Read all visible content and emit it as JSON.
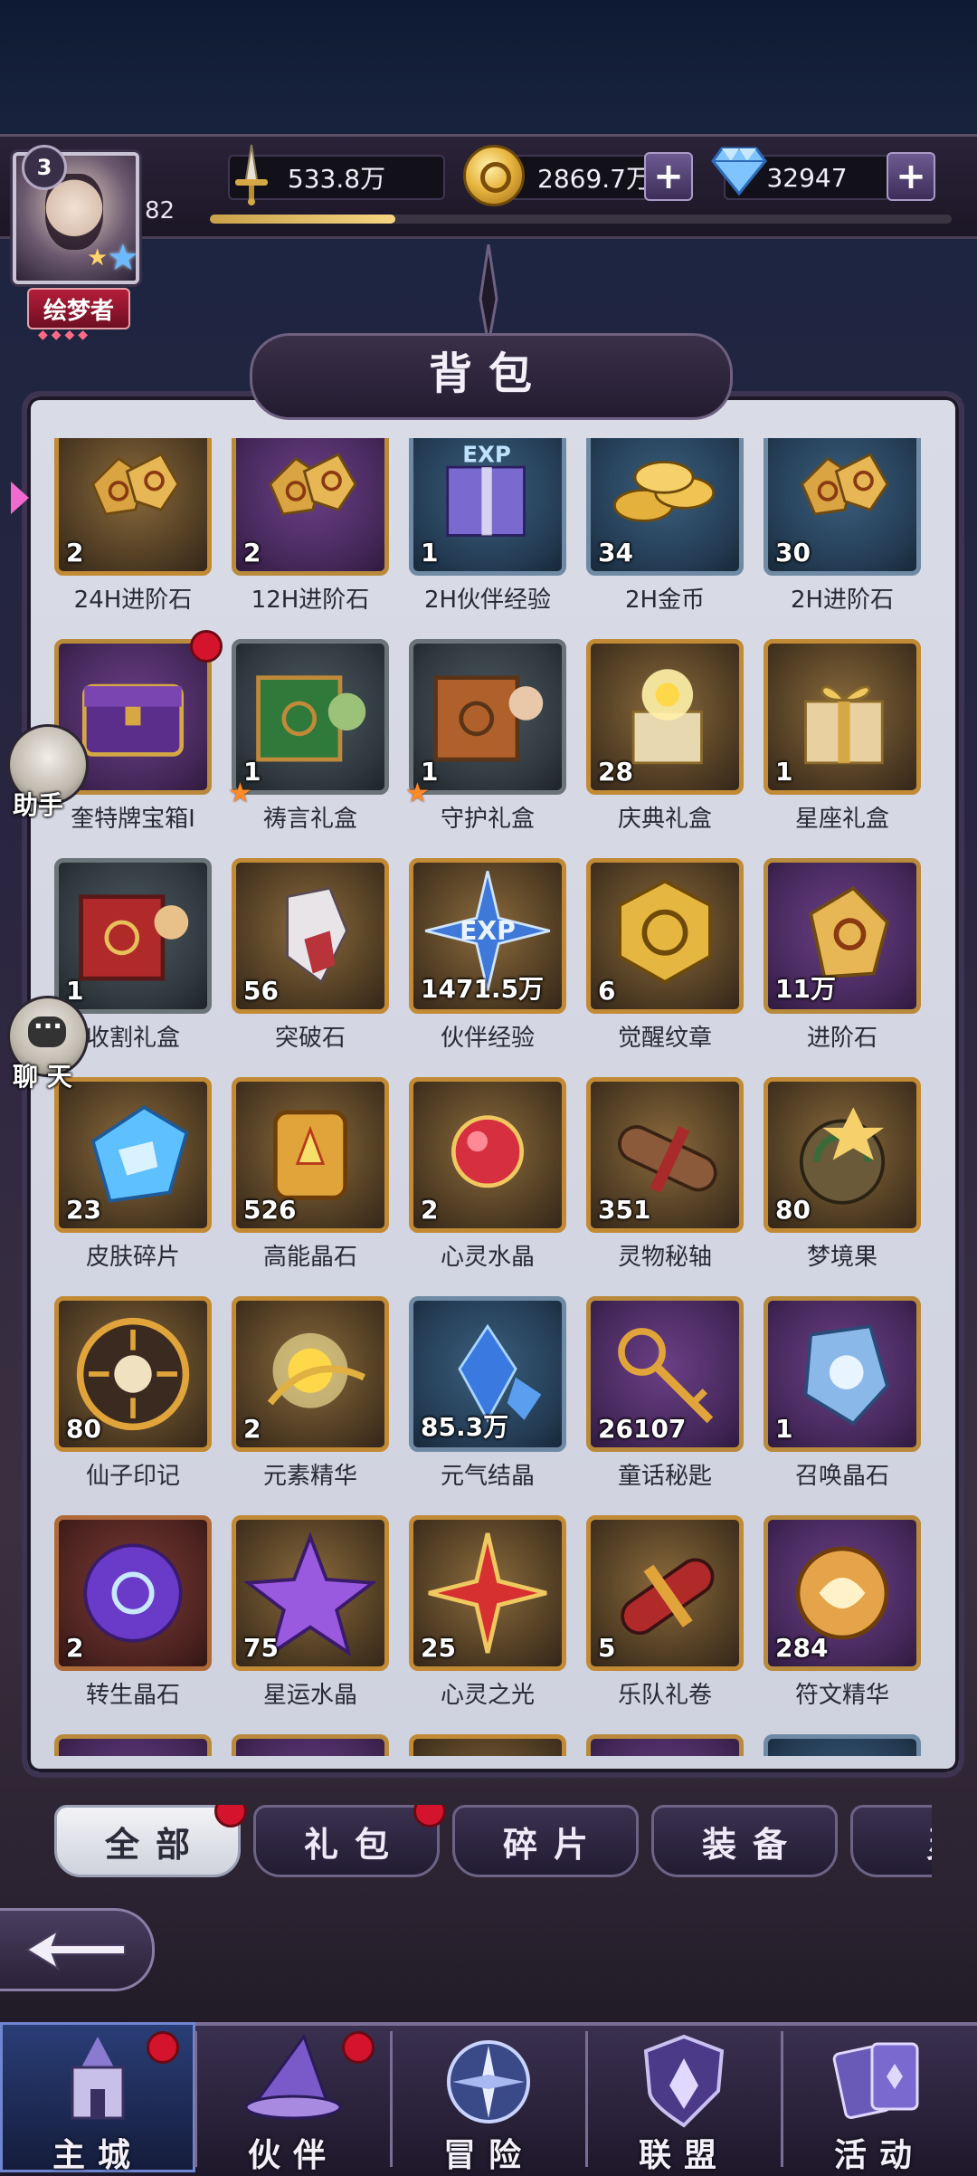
{
  "hud": {
    "player_rank": "3",
    "player_level": "82",
    "title": "绘梦者",
    "title_gems": "◆◆◆◆",
    "exp_fraction": 0.25,
    "power_value": "533.8万",
    "gold_value": "2869.7万",
    "gem_value": "32947"
  },
  "panel": {
    "title": "背包"
  },
  "side": {
    "assistant_label": "助手",
    "chat_label": "聊 天"
  },
  "items": [
    {
      "name": "24H进阶石",
      "count": "2",
      "bg": "gold",
      "art": "stones",
      "badge": ""
    },
    {
      "name": "12H进阶石",
      "count": "2",
      "bg": "purple",
      "art": "stones",
      "badge": ""
    },
    {
      "name": "2H伙伴经验",
      "count": "1",
      "bg": "blue",
      "art": "giftbox-exp",
      "badge": ""
    },
    {
      "name": "2H金币",
      "count": "34",
      "bg": "blue",
      "art": "coins",
      "badge": ""
    },
    {
      "name": "2H进阶石",
      "count": "30",
      "bg": "blue",
      "art": "stones",
      "badge": ""
    },
    {
      "name": "奎特牌宝箱I",
      "count": "",
      "bg": "purple",
      "art": "chest",
      "badge": "reddot"
    },
    {
      "name": "祷言礼盒",
      "count": "1",
      "bg": "grey",
      "art": "crate-green",
      "badge": "star"
    },
    {
      "name": "守护礼盒",
      "count": "1",
      "bg": "grey",
      "art": "crate-orange",
      "badge": "star"
    },
    {
      "name": "庆典礼盒",
      "count": "28",
      "bg": "gold",
      "art": "gift-open",
      "badge": ""
    },
    {
      "name": "星座礼盒",
      "count": "1",
      "bg": "gold",
      "art": "gift-bow",
      "badge": ""
    },
    {
      "name": "收割礼盒",
      "count": "1",
      "bg": "grey",
      "art": "crate-red",
      "badge": "star"
    },
    {
      "name": "突破石",
      "count": "56",
      "bg": "gold",
      "art": "crystal-white",
      "badge": ""
    },
    {
      "name": "伙伴经验",
      "count": "1471.5万",
      "bg": "gold",
      "art": "exp-star",
      "badge": ""
    },
    {
      "name": "觉醒纹章",
      "count": "6",
      "bg": "gold",
      "art": "emblem",
      "badge": ""
    },
    {
      "name": "进阶石",
      "count": "11万",
      "bg": "purple",
      "art": "stone-single",
      "badge": ""
    },
    {
      "name": "皮肤碎片",
      "count": "23",
      "bg": "gold",
      "art": "blue-gem",
      "badge": ""
    },
    {
      "name": "高能晶石",
      "count": "526",
      "bg": "gold",
      "art": "gold-frame",
      "badge": ""
    },
    {
      "name": "心灵水晶",
      "count": "2",
      "bg": "gold",
      "art": "red-heart",
      "badge": ""
    },
    {
      "name": "灵物秘轴",
      "count": "351",
      "bg": "gold",
      "art": "scroll-brown",
      "badge": ""
    },
    {
      "name": "梦境果",
      "count": "80",
      "bg": "gold",
      "art": "dream-fruit",
      "badge": ""
    },
    {
      "name": "仙子印记",
      "count": "80",
      "bg": "gold",
      "art": "sun-seal",
      "badge": ""
    },
    {
      "name": "元素精华",
      "count": "2",
      "bg": "gold",
      "art": "glow-orb",
      "badge": ""
    },
    {
      "name": "元气结晶",
      "count": "85.3万",
      "bg": "blue",
      "art": "blue-crystals",
      "badge": ""
    },
    {
      "name": "童话秘匙",
      "count": "26107",
      "bg": "purple",
      "art": "key",
      "badge": ""
    },
    {
      "name": "召唤晶石",
      "count": "1",
      "bg": "purple",
      "art": "rune-stone",
      "badge": ""
    },
    {
      "name": "转生晶石",
      "count": "2",
      "bg": "red",
      "art": "purple-orb",
      "badge": ""
    },
    {
      "name": "星运水晶",
      "count": "75",
      "bg": "gold",
      "art": "purple-star",
      "badge": ""
    },
    {
      "name": "心灵之光",
      "count": "25",
      "bg": "gold",
      "art": "red-star",
      "badge": ""
    },
    {
      "name": "乐队礼卷",
      "count": "5",
      "bg": "gold",
      "art": "scroll-red",
      "badge": ""
    },
    {
      "name": "符文精华",
      "count": "284",
      "bg": "purple",
      "art": "rune-orb",
      "badge": ""
    },
    {
      "name": "",
      "count": "",
      "bg": "purple",
      "art": "",
      "badge": ""
    },
    {
      "name": "",
      "count": "",
      "bg": "purple",
      "art": "",
      "badge": ""
    },
    {
      "name": "",
      "count": "",
      "bg": "gold",
      "art": "",
      "badge": ""
    },
    {
      "name": "",
      "count": "",
      "bg": "purple",
      "art": "",
      "badge": ""
    },
    {
      "name": "",
      "count": "",
      "bg": "blue",
      "art": "",
      "badge": ""
    }
  ],
  "tabs": [
    {
      "label": "全部",
      "active": true,
      "reddot": true
    },
    {
      "label": "礼包",
      "active": false,
      "reddot": true
    },
    {
      "label": "碎片",
      "active": false,
      "reddot": false
    },
    {
      "label": "装备",
      "active": false,
      "reddot": false
    },
    {
      "label": "灵",
      "active": false,
      "reddot": false
    }
  ],
  "nav": [
    {
      "label": "主城",
      "active": true,
      "reddot": true,
      "icon": "castle-icon"
    },
    {
      "label": "伙伴",
      "active": false,
      "reddot": true,
      "icon": "witch-hat-icon"
    },
    {
      "label": "冒险",
      "active": false,
      "reddot": false,
      "icon": "compass-icon"
    },
    {
      "label": "联盟",
      "active": false,
      "reddot": false,
      "icon": "shield-icon"
    },
    {
      "label": "活动",
      "active": false,
      "reddot": false,
      "icon": "cards-icon"
    }
  ],
  "colors": {
    "reddot": "#d4142c",
    "panel_bg": "#d9dbe6",
    "frame": "#3c3450",
    "exp_fill": "#f6d583"
  }
}
